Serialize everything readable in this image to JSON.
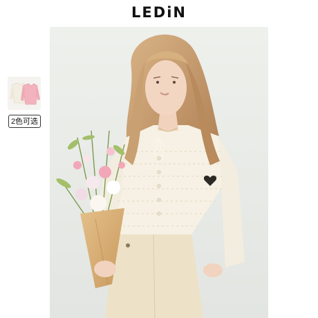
{
  "brand": {
    "logo_text": "LEDiN"
  },
  "product": {
    "color_options_label": "2色可选",
    "thumbnail_colors": [
      "#f3eee2",
      "#f2b3bf"
    ]
  },
  "colors": {
    "background": "#ffffff",
    "photo_backdrop": "#e6e9e5",
    "cardigan": "#f6f1e4",
    "skirt": "#ede2c8",
    "hair": "#c59a6b",
    "bouquet_wrap": "#d9b27a",
    "flowers_pink": "#f2a7b8"
  }
}
